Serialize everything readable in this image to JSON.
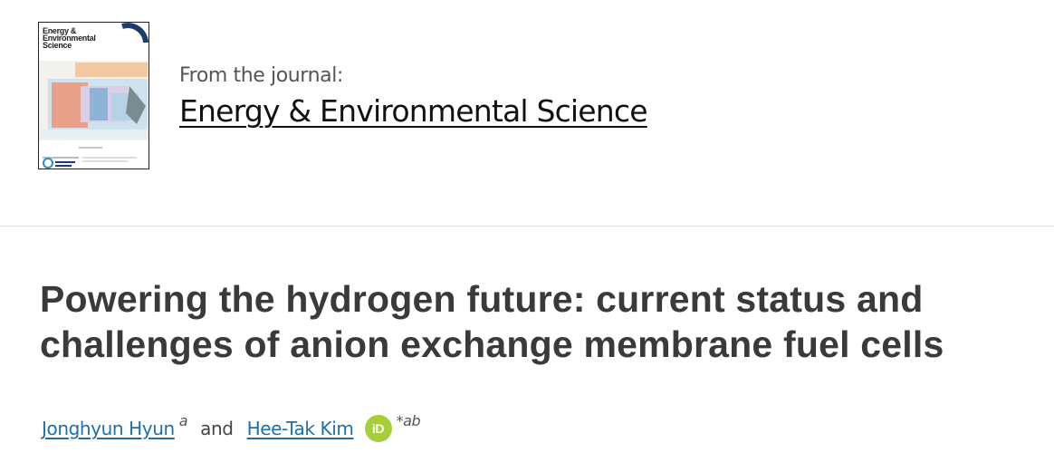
{
  "journal": {
    "cover": {
      "title_line1": "Energy &",
      "title_line2": "Environmental",
      "title_line3": "Science"
    },
    "from_label": "From the journal:",
    "name": "Energy & Environmental Science"
  },
  "article": {
    "title": "Powering the hydrogen future: current status and challenges of anion exchange membrane fuel cells"
  },
  "authors": [
    {
      "name": "Jonghyun Hyun",
      "affiliation": "a"
    },
    {
      "name": "Hee-Tak Kim",
      "affiliation": "*ab",
      "orcid_label": "iD"
    }
  ],
  "authors_conjunction": "and",
  "colors": {
    "link": "#1f6fa8",
    "orcid": "#a6ce39",
    "title": "#3a3a3a"
  }
}
